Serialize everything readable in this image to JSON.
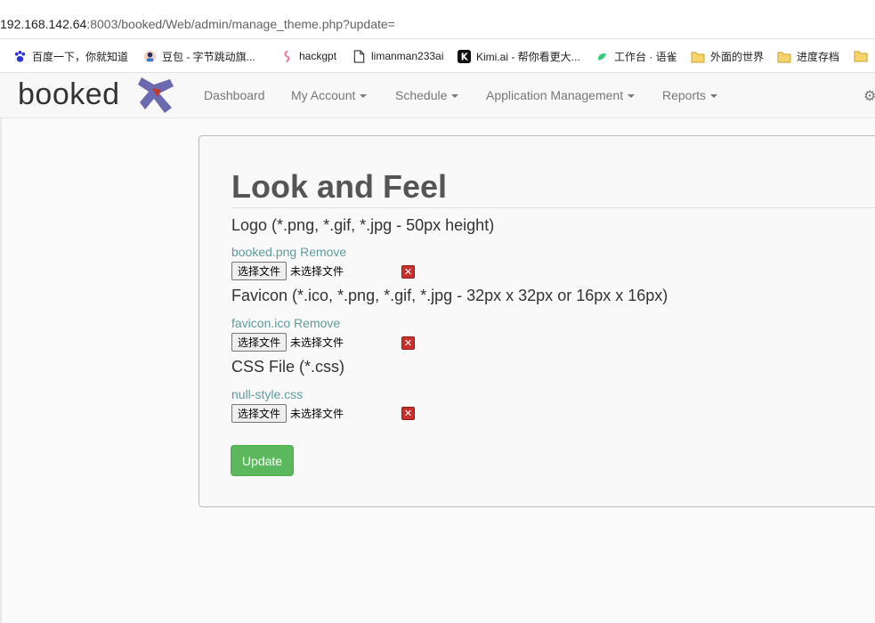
{
  "browser": {
    "url_host": "192.168.142.64",
    "url_rest": ":8003/booked/Web/admin/manage_theme.php?update=",
    "bookmarks": [
      {
        "label": "百度一下，你就知道",
        "icon": "baidu-paw-icon"
      },
      {
        "label": "豆包 - 字节跳动旗...",
        "icon": "doubao-icon"
      },
      {
        "label": "hackgpt",
        "icon": "seahorse-icon"
      },
      {
        "label": "limanman233ai",
        "icon": "page-icon"
      },
      {
        "label": "Kimi.ai - 帮你看更大...",
        "icon": "kimi-icon"
      },
      {
        "label": "工作台 · 语雀",
        "icon": "yuque-icon"
      },
      {
        "label": "外面的世界",
        "icon": "folder-icon"
      },
      {
        "label": "进度存档",
        "icon": "folder-icon"
      }
    ]
  },
  "navbar": {
    "brand": "booked",
    "items": [
      {
        "label": "Dashboard",
        "dropdown": false
      },
      {
        "label": "My Account",
        "dropdown": true
      },
      {
        "label": "Schedule",
        "dropdown": true
      },
      {
        "label": "Application Management",
        "dropdown": true
      },
      {
        "label": "Reports",
        "dropdown": true
      }
    ]
  },
  "main": {
    "title": "Look and Feel",
    "sections": [
      {
        "label": "Logo (*.png, *.gif, *.jpg - 50px height)",
        "file": "booked.png",
        "remove": "Remove"
      },
      {
        "label": "Favicon (*.ico, *.png, *.gif, *.jpg - 32px x 32px or 16px x 16px)",
        "file": "favicon.ico",
        "remove": "Remove"
      },
      {
        "label": "CSS File (*.css)",
        "file": "null-style.css",
        "remove": ""
      }
    ],
    "choose_label": "选择文件",
    "no_file_label": "未选择文件",
    "update_label": "Update"
  },
  "colors": {
    "accent_link": "#5e9d9b",
    "update_button": "#5cb85c",
    "delete_icon": "#c9302c",
    "logo_purple": "#5b5aa8",
    "logo_red": "#c0392b"
  }
}
